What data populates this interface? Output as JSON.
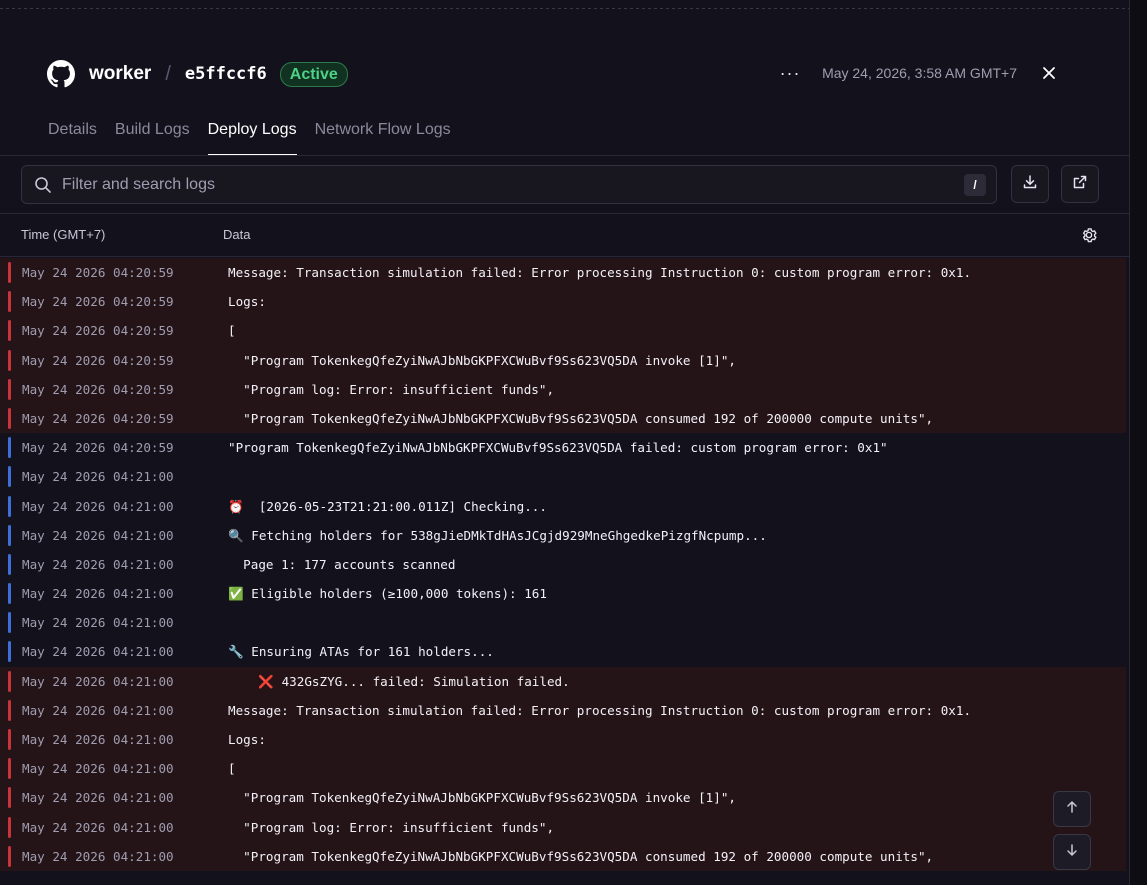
{
  "header": {
    "service_name": "worker",
    "separator": "/",
    "deployment_id": "e5ffccf6",
    "status": "Active",
    "timestamp": "May 24, 2026, 3:58 AM GMT+7",
    "more_label": "···"
  },
  "tabs": [
    {
      "label": "Details",
      "active": false
    },
    {
      "label": "Build Logs",
      "active": false
    },
    {
      "label": "Deploy Logs",
      "active": true
    },
    {
      "label": "Network Flow Logs",
      "active": false
    }
  ],
  "search": {
    "placeholder": "Filter and search logs",
    "shortcut": "/"
  },
  "columns": {
    "time": "Time (GMT+7)",
    "data": "Data"
  },
  "colors": {
    "error_bar": "#c8333c",
    "info_bar": "#3e6fd8",
    "active_badge": "#4cd185"
  },
  "logs": [
    {
      "level": "error",
      "time": "May 24 2026 04:20:59",
      "message": "Message: Transaction simulation failed: Error processing Instruction 0: custom program error: 0x1."
    },
    {
      "level": "error",
      "time": "May 24 2026 04:20:59",
      "message": "Logs:"
    },
    {
      "level": "error",
      "time": "May 24 2026 04:20:59",
      "message": "["
    },
    {
      "level": "error",
      "time": "May 24 2026 04:20:59",
      "message": "  \"Program TokenkegQfeZyiNwAJbNbGKPFXCWuBvf9Ss623VQ5DA invoke [1]\","
    },
    {
      "level": "error",
      "time": "May 24 2026 04:20:59",
      "message": "  \"Program log: Error: insufficient funds\","
    },
    {
      "level": "error",
      "time": "May 24 2026 04:20:59",
      "message": "  \"Program TokenkegQfeZyiNwAJbNbGKPFXCWuBvf9Ss623VQ5DA consumed 192 of 200000 compute units\","
    },
    {
      "level": "info",
      "time": "May 24 2026 04:20:59",
      "message": "\"Program TokenkegQfeZyiNwAJbNbGKPFXCWuBvf9Ss623VQ5DA failed: custom program error: 0x1\""
    },
    {
      "level": "info",
      "time": "May 24 2026 04:21:00",
      "message": ""
    },
    {
      "level": "info",
      "time": "May 24 2026 04:21:00",
      "message": "⏰  [2026-05-23T21:21:00.011Z] Checking..."
    },
    {
      "level": "info",
      "time": "May 24 2026 04:21:00",
      "message": "🔍 Fetching holders for 538gJieDMkTdHAsJCgjd929MneGhgedkePizgfNcpump..."
    },
    {
      "level": "info",
      "time": "May 24 2026 04:21:00",
      "message": "  Page 1: 177 accounts scanned"
    },
    {
      "level": "info",
      "time": "May 24 2026 04:21:00",
      "message": "✅ Eligible holders (≥100,000 tokens): 161"
    },
    {
      "level": "info",
      "time": "May 24 2026 04:21:00",
      "message": ""
    },
    {
      "level": "info",
      "time": "May 24 2026 04:21:00",
      "message": "🔧 Ensuring ATAs for 161 holders..."
    },
    {
      "level": "error",
      "time": "May 24 2026 04:21:00",
      "message": "    ❌ 432GsZYG... failed: Simulation failed."
    },
    {
      "level": "error",
      "time": "May 24 2026 04:21:00",
      "message": "Message: Transaction simulation failed: Error processing Instruction 0: custom program error: 0x1."
    },
    {
      "level": "error",
      "time": "May 24 2026 04:21:00",
      "message": "Logs:"
    },
    {
      "level": "error",
      "time": "May 24 2026 04:21:00",
      "message": "["
    },
    {
      "level": "error",
      "time": "May 24 2026 04:21:00",
      "message": "  \"Program TokenkegQfeZyiNwAJbNbGKPFXCWuBvf9Ss623VQ5DA invoke [1]\","
    },
    {
      "level": "error",
      "time": "May 24 2026 04:21:00",
      "message": "  \"Program log: Error: insufficient funds\","
    },
    {
      "level": "error",
      "time": "May 24 2026 04:21:00",
      "message": "  \"Program TokenkegQfeZyiNwAJbNbGKPFXCWuBvf9Ss623VQ5DA consumed 192 of 200000 compute units\","
    }
  ]
}
